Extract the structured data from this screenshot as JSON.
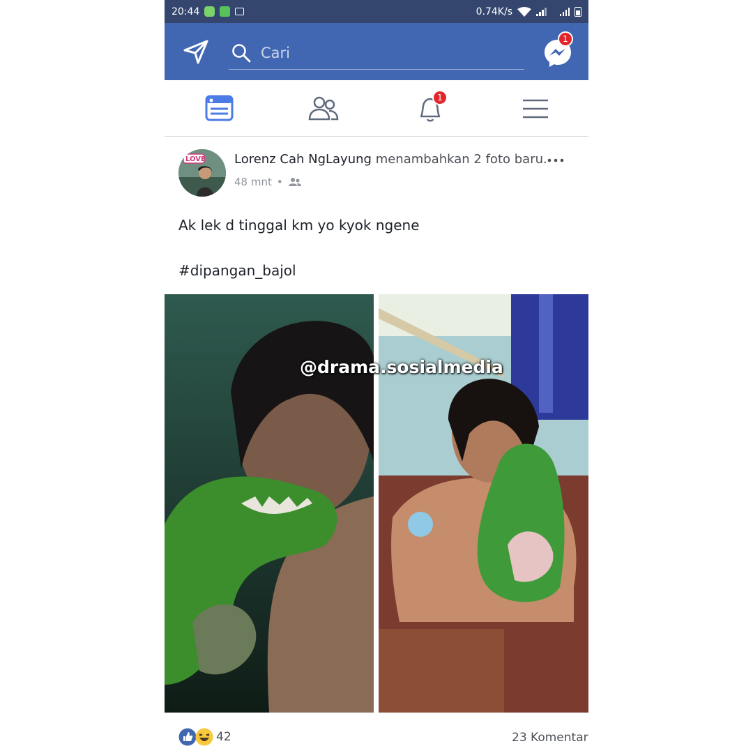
{
  "status_bar": {
    "time": "20:44",
    "network_speed": "0.74K/s",
    "icons": [
      "line-icon",
      "whatsapp-icon",
      "image-icon",
      "wifi-icon",
      "signal-icon",
      "signal-icon",
      "battery-icon"
    ]
  },
  "top_nav": {
    "search_placeholder": "Cari",
    "messenger_badge": "1",
    "colors": {
      "bar": "#4267b2",
      "status_bar": "#34466e"
    }
  },
  "tabs": [
    {
      "name": "news-feed",
      "icon": "news-feed-icon"
    },
    {
      "name": "friends",
      "icon": "friends-icon"
    },
    {
      "name": "notifications",
      "icon": "bell-icon",
      "badge": "1"
    },
    {
      "name": "menu",
      "icon": "hamburger-menu-icon"
    }
  ],
  "post": {
    "author": "Lorenz Cah NgLayung",
    "action": "menambahkan 2 foto baru.",
    "time": "48 mnt",
    "separator": "•",
    "audience_icon": "friends-icon",
    "avatar_text": "LOVE",
    "text": "Ak lek d tinggal km yo kyok ngene",
    "hashtag": "#dipangan_bajol",
    "watermark": "@drama.sosialmedia",
    "reactions": {
      "icons": [
        "like-icon",
        "haha-icon"
      ],
      "count": "42"
    },
    "comments": "23 Komentar"
  }
}
